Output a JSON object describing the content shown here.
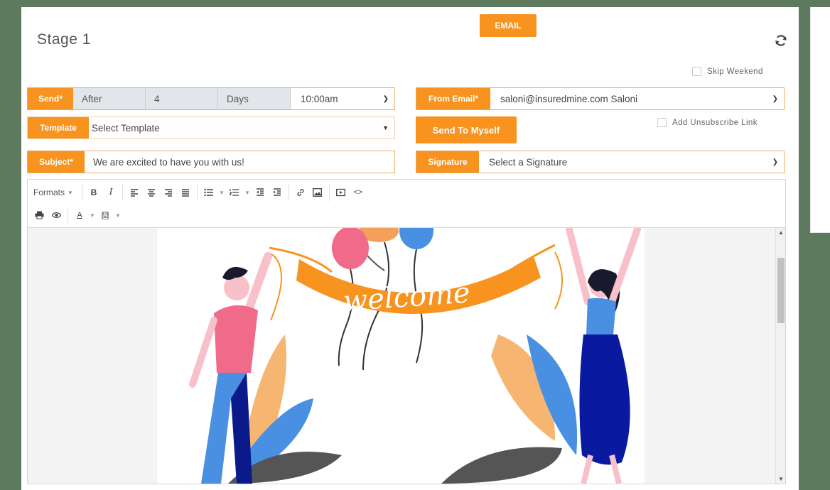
{
  "stage": {
    "title": "Stage 1"
  },
  "email_button": "EMAIL",
  "skip_weekend": "Skip Weekend",
  "send": {
    "label": "Send*",
    "after": "After",
    "count": "4",
    "unit": "Days",
    "time": "10:00am"
  },
  "from_email": {
    "label": "From Email*",
    "value": "saloni@insuredmine.com Saloni"
  },
  "template": {
    "label": "Template",
    "value": "Select Template"
  },
  "send_to_myself": "Send To Myself",
  "add_unsubscribe": "Add Unsubscribe Link",
  "subject": {
    "label": "Subject*",
    "value": "We are excited to have you with us!"
  },
  "signature": {
    "label": "Signature",
    "value": "Select a Signature"
  },
  "toolbar": {
    "formats": "Formats"
  },
  "artwork": {
    "banner_text": "welcome"
  },
  "colors": {
    "accent": "#f7931e",
    "background": "#5e7a5e"
  }
}
